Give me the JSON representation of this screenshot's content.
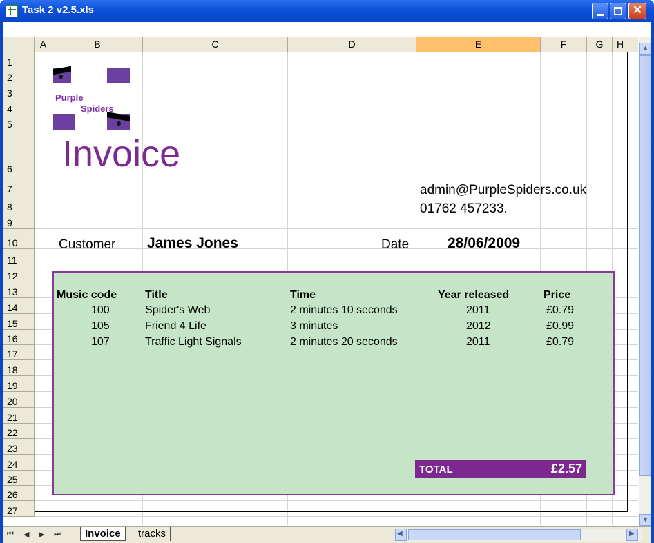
{
  "window": {
    "title": "Task 2 v2.5.xls"
  },
  "columns": [
    "A",
    "B",
    "C",
    "D",
    "E",
    "F",
    "G",
    "H"
  ],
  "rows": [
    "1",
    "2",
    "3",
    "4",
    "5",
    "6",
    "7",
    "8",
    "9",
    "10",
    "11",
    "12",
    "13",
    "14",
    "15",
    "16",
    "17",
    "18",
    "19",
    "20",
    "21",
    "22",
    "23",
    "24",
    "25",
    "26",
    "27"
  ],
  "selected_column": "E",
  "logo": {
    "line1": "Purple",
    "line2": "Spiders"
  },
  "invoice": {
    "title": "Invoice",
    "email": "admin@PurpleSpiders.co.uk",
    "phone": "01762 457233.",
    "customer_label": "Customer",
    "customer_name": "James Jones",
    "date_label": "Date",
    "date_value": "28/06/2009"
  },
  "table": {
    "headers": [
      "Music code",
      "Title",
      "Time",
      "Year released",
      "Price"
    ],
    "rows": [
      [
        "100",
        "Spider's Web",
        "2 minutes 10 seconds",
        "2011",
        "£0.79"
      ],
      [
        "105",
        "Friend 4 Life",
        "3 minutes",
        "2012",
        "£0.99"
      ],
      [
        "107",
        "Traffic Light Signals",
        "2 minutes 20 seconds",
        "2011",
        "£0.79"
      ]
    ],
    "total_label": "TOTAL",
    "total_value": "£2.57"
  },
  "sheet_tabs": [
    "Invoice",
    "tracks"
  ],
  "active_tab": "Invoice",
  "colors": {
    "accent": "#7c2890",
    "table_bg": "#c6e4c6",
    "title_bar": "#0b50d8"
  }
}
